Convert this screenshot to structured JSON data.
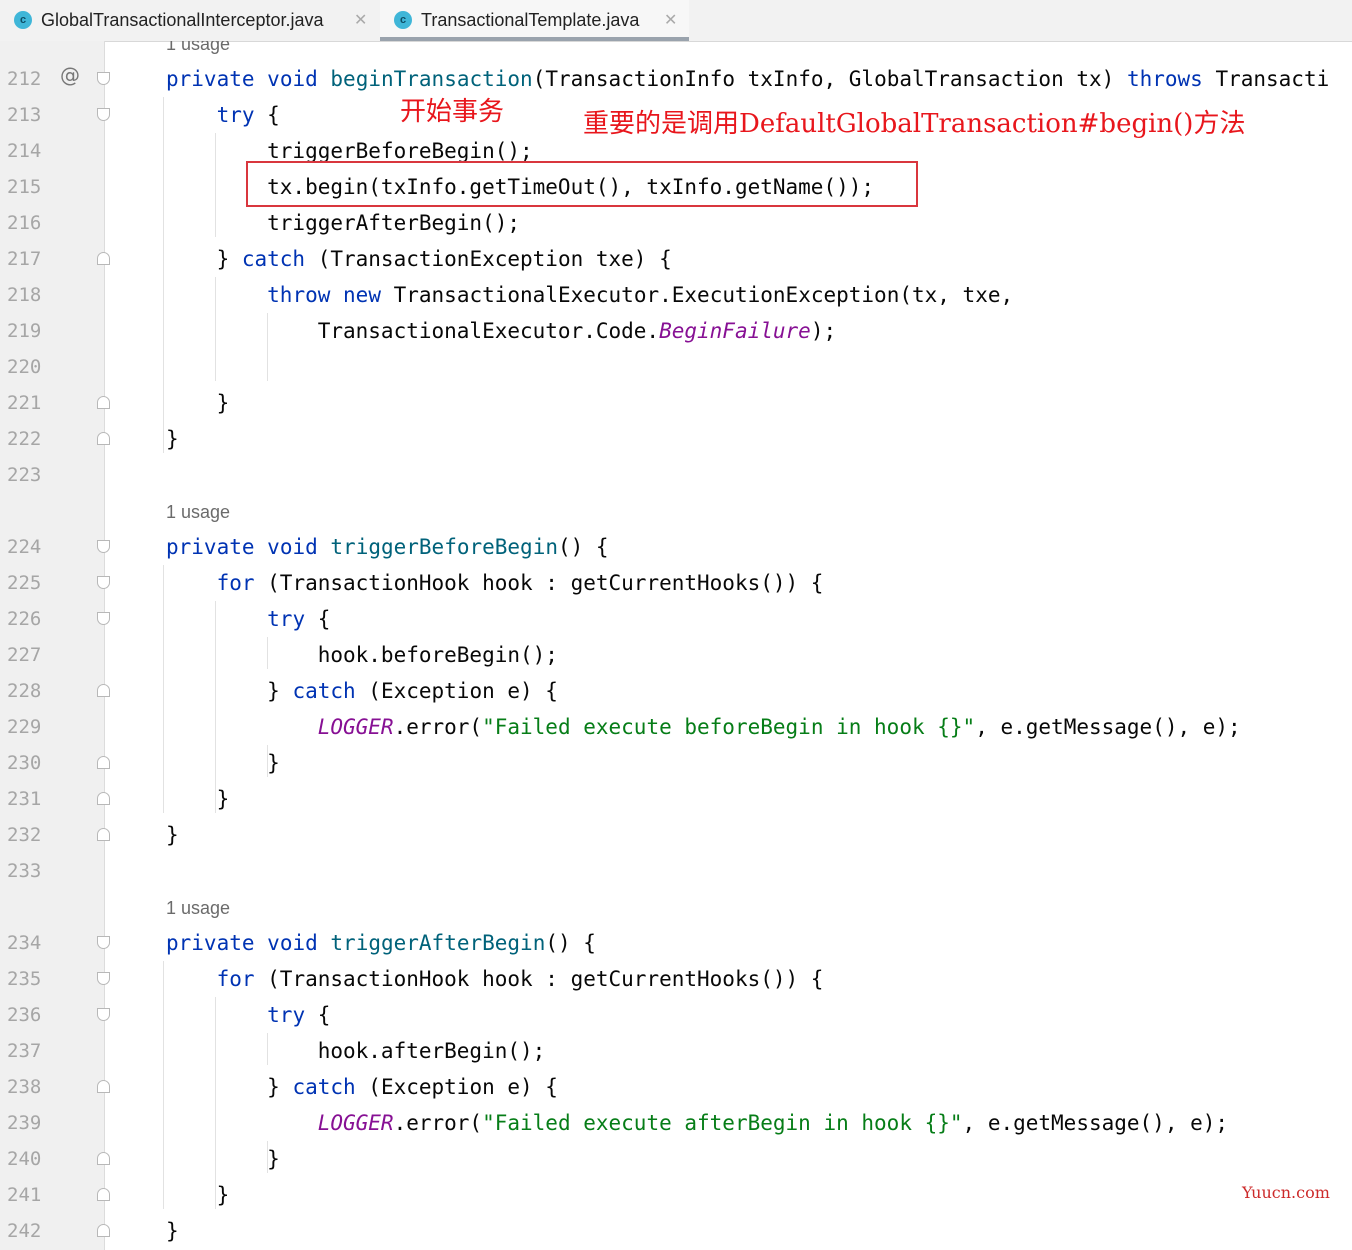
{
  "tabs": [
    {
      "label": "GlobalTransactionalInterceptor.java",
      "icon": "class-c-icon",
      "active": false
    },
    {
      "label": "TransactionalTemplate.java",
      "icon": "class-c-icon",
      "active": true
    }
  ],
  "tab_icon_letter": "c",
  "close_glyph": "✕",
  "gutter_override_glyph": "@",
  "usage_hint": "1 usage",
  "annotations": {
    "start": "开始事务",
    "important": "重要的是调用DefaultGlobalTransaction#begin()方法"
  },
  "watermark": "Yuucn.com",
  "colors": {
    "keyword": "#0033b3",
    "method": "#00627a",
    "string": "#067d17",
    "field": "#871094",
    "annotation": "#e8161c"
  },
  "lines": [
    {
      "n": "212",
      "text": "private void beginTransaction(TransactionInfo txInfo, GlobalTransaction tx) throws Transacti"
    },
    {
      "n": "213",
      "text": "try {"
    },
    {
      "n": "214",
      "text": "triggerBeforeBegin();"
    },
    {
      "n": "215",
      "text": "tx.begin(txInfo.getTimeOut(), txInfo.getName());"
    },
    {
      "n": "216",
      "text": "triggerAfterBegin();"
    },
    {
      "n": "217",
      "text": "} catch (TransactionException txe) {"
    },
    {
      "n": "218",
      "text": "throw new TransactionalExecutor.ExecutionException(tx, txe,"
    },
    {
      "n": "219",
      "text": "TransactionalExecutor.Code.BeginFailure);"
    },
    {
      "n": "220",
      "text": ""
    },
    {
      "n": "221",
      "text": "}"
    },
    {
      "n": "222",
      "text": "}"
    },
    {
      "n": "223",
      "text": ""
    },
    {
      "n": "224",
      "text": "private void triggerBeforeBegin() {"
    },
    {
      "n": "225",
      "text": "for (TransactionHook hook : getCurrentHooks()) {"
    },
    {
      "n": "226",
      "text": "try {"
    },
    {
      "n": "227",
      "text": "hook.beforeBegin();"
    },
    {
      "n": "228",
      "text": "} catch (Exception e) {"
    },
    {
      "n": "229",
      "text": "LOGGER.error(\"Failed execute beforeBegin in hook {}\", e.getMessage(), e);"
    },
    {
      "n": "230",
      "text": "}"
    },
    {
      "n": "231",
      "text": "}"
    },
    {
      "n": "232",
      "text": "}"
    },
    {
      "n": "233",
      "text": ""
    },
    {
      "n": "234",
      "text": "private void triggerAfterBegin() {"
    },
    {
      "n": "235",
      "text": "for (TransactionHook hook : getCurrentHooks()) {"
    },
    {
      "n": "236",
      "text": "try {"
    },
    {
      "n": "237",
      "text": "hook.afterBegin();"
    },
    {
      "n": "238",
      "text": "} catch (Exception e) {"
    },
    {
      "n": "239",
      "text": "LOGGER.error(\"Failed execute afterBegin in hook {}\", e.getMessage(), e);"
    },
    {
      "n": "240",
      "text": "}"
    },
    {
      "n": "241",
      "text": "}"
    },
    {
      "n": "242",
      "text": "}"
    }
  ]
}
